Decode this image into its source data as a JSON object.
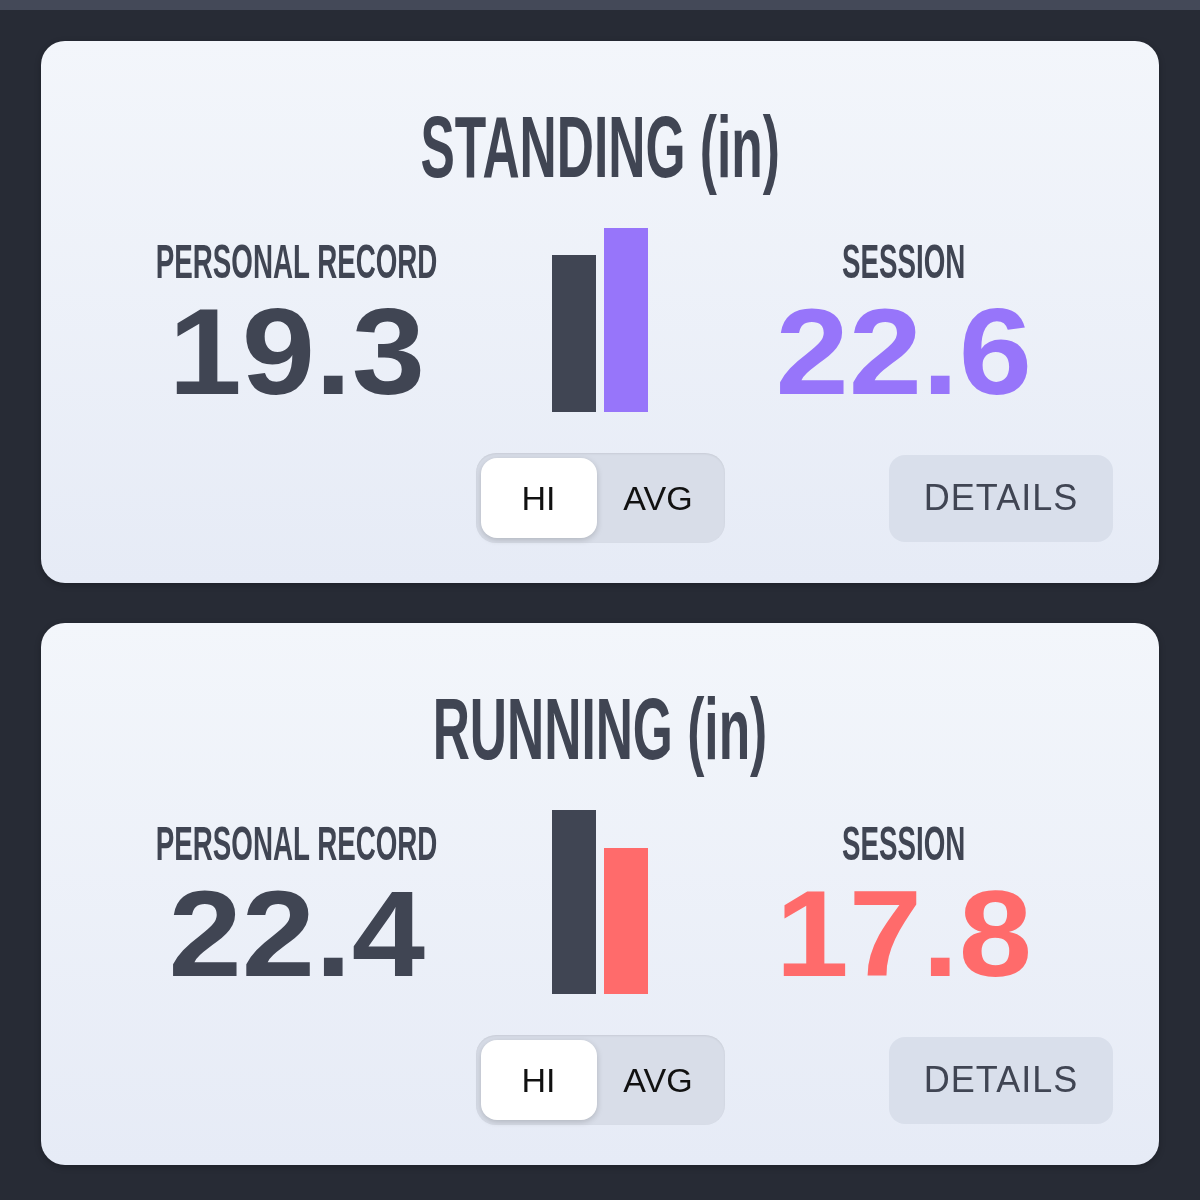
{
  "cards": [
    {
      "title": "STANDING (in)",
      "personal_record": {
        "label": "PERSONAL RECORD",
        "value": "19.3"
      },
      "session": {
        "label": "SESSION",
        "value": "22.6",
        "color": "#9775fa"
      },
      "mode_toggle": [
        {
          "label": "HI",
          "selected": true
        },
        {
          "label": "AVG",
          "selected": false
        }
      ],
      "details_button": "DETAILS"
    },
    {
      "title": "RUNNING (in)",
      "personal_record": {
        "label": "PERSONAL RECORD",
        "value": "22.4"
      },
      "session": {
        "label": "SESSION",
        "value": "17.8",
        "color": "#ff6b6b"
      },
      "mode_toggle": [
        {
          "label": "HI",
          "selected": true
        },
        {
          "label": "AVG",
          "selected": false
        }
      ],
      "details_button": "DETAILS"
    }
  ]
}
